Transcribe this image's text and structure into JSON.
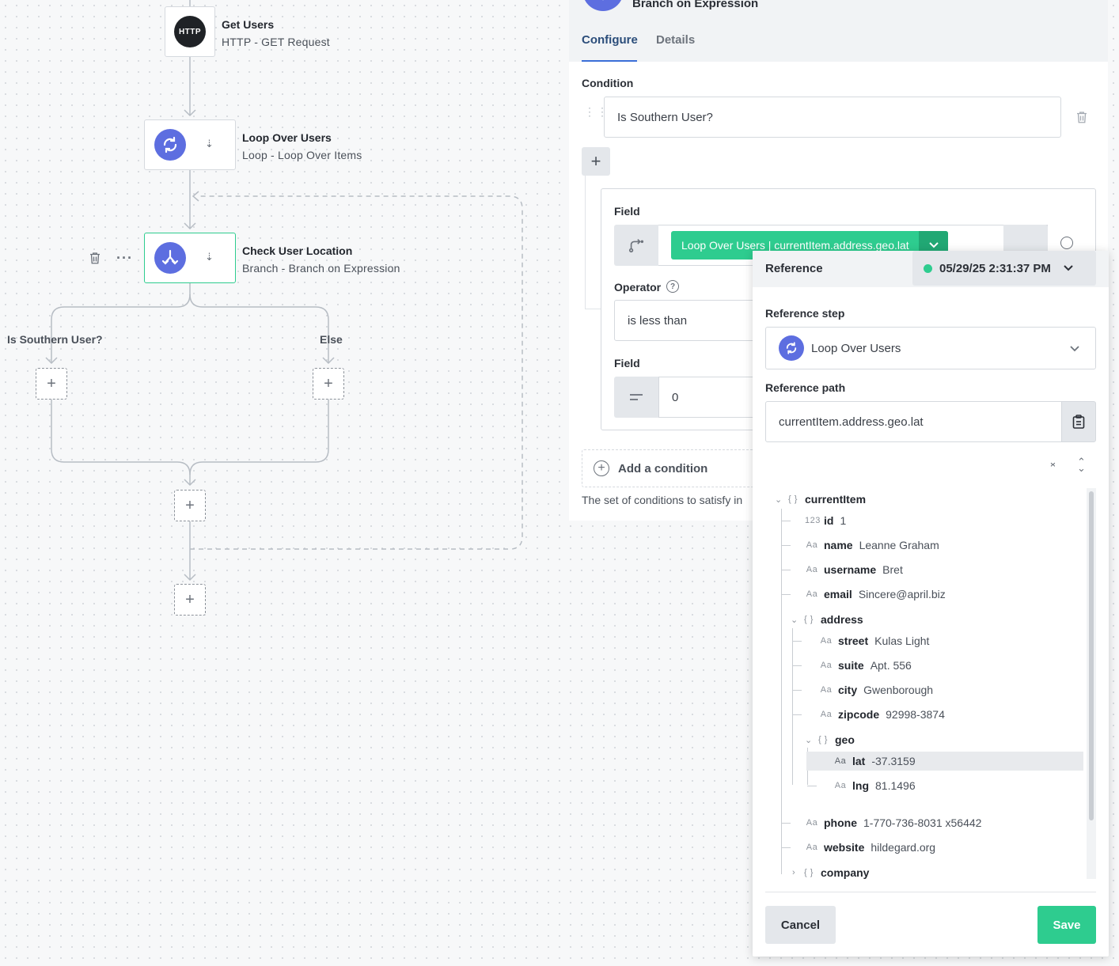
{
  "canvas": {
    "nodes": {
      "get_users": {
        "title": "Get Users",
        "subtitle": "HTTP - GET Request",
        "icon_text": "HTTP",
        "icon": "http-icon"
      },
      "loop_over_users": {
        "title": "Loop Over Users",
        "subtitle": "Loop - Loop Over Items",
        "icon": "loop-icon"
      },
      "check_user_location": {
        "title": "Check User Location",
        "subtitle": "Branch - Branch on Expression",
        "icon": "branch-icon"
      }
    },
    "branches": {
      "left": "Is Southern User?",
      "right": "Else"
    },
    "accent_color": "#2ecc8f",
    "node_icon_color": "#5d6ee0"
  },
  "panel": {
    "header_title": "Branch on Expression",
    "tabs": [
      {
        "label": "Configure",
        "active": true
      },
      {
        "label": "Details",
        "active": false
      }
    ],
    "condition_label": "Condition",
    "condition_name": "Is Southern User?",
    "field_label": "Field",
    "field_reference_pill": "Loop Over Users | currentItem.address.geo.lat",
    "operator_label": "Operator",
    "operator_value": "is less than",
    "field2_label": "Field",
    "field2_value": "0",
    "add_condition": "Add a condition",
    "helper_text": "The set of conditions to satisfy in"
  },
  "reference_popup": {
    "title": "Reference",
    "timestamp": "05/29/25 2:31:37 PM",
    "status_color": "#2ecc8f",
    "reference_step_label": "Reference step",
    "reference_step_value": "Loop Over Users",
    "reference_path_label": "Reference path",
    "reference_path_value": "currentItem.address.geo.lat",
    "tree": {
      "root": "currentItem",
      "id_key": "id",
      "id_val": "1",
      "name_key": "name",
      "name_val": "Leanne Graham",
      "username_key": "username",
      "username_val": "Bret",
      "email_key": "email",
      "email_val": "Sincere@april.biz",
      "address_key": "address",
      "street_key": "street",
      "street_val": "Kulas Light",
      "suite_key": "suite",
      "suite_val": "Apt. 556",
      "city_key": "city",
      "city_val": "Gwenborough",
      "zipcode_key": "zipcode",
      "zipcode_val": "92998-3874",
      "geo_key": "geo",
      "lat_key": "lat",
      "lat_val": "-37.3159",
      "lng_key": "lng",
      "lng_val": "81.1496",
      "phone_key": "phone",
      "phone_val": "1-770-736-8031 x56442",
      "website_key": "website",
      "website_val": "hildegard.org",
      "company_key": "company"
    },
    "type_glyphs": {
      "object": "{ }",
      "number": "123",
      "string": "Aa"
    },
    "cancel_label": "Cancel",
    "save_label": "Save"
  }
}
